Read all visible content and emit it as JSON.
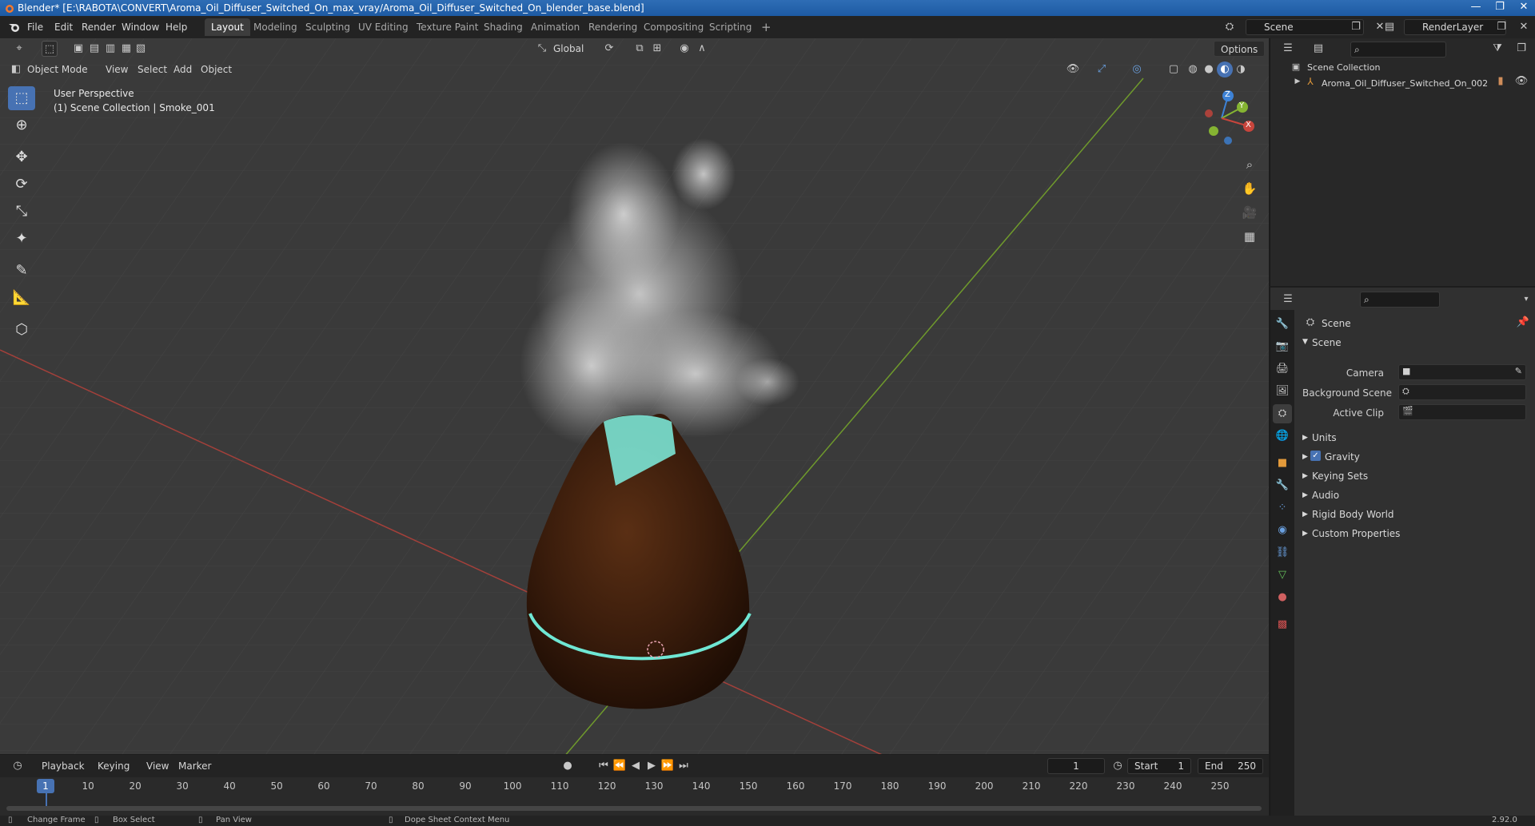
{
  "window": {
    "title": "Blender* [E:\\RABOTA\\CONVERT\\Aroma_Oil_Diffuser_Switched_On_max_vray/Aroma_Oil_Diffuser_Switched_On_blender_base.blend]",
    "minimize": "—",
    "maximize": "❐",
    "close": "✕"
  },
  "menu": [
    "File",
    "Edit",
    "Render",
    "Window",
    "Help"
  ],
  "workspaces": [
    "Layout",
    "Modeling",
    "Sculpting",
    "UV Editing",
    "Texture Paint",
    "Shading",
    "Animation",
    "Rendering",
    "Compositing",
    "Scripting"
  ],
  "active_workspace": "Layout",
  "add_workspace": "+",
  "scene_name": "Scene",
  "render_layer": "RenderLayer",
  "viewport": {
    "mode": "Object Mode",
    "menus": [
      "View",
      "Select",
      "Add",
      "Object"
    ],
    "transform_orientation": "Global",
    "options": "Options",
    "view_name": "User Perspective",
    "collection_info": "(1) Scene Collection | Smoke_001"
  },
  "gizmo": {
    "z": "Z",
    "y": "Y",
    "x": "X"
  },
  "outliner": {
    "root": "Scene Collection",
    "items": [
      "Aroma_Oil_Diffuser_Switched_On_002"
    ]
  },
  "properties": {
    "header": "Scene",
    "panel": "Scene",
    "camera_label": "Camera",
    "background_scene_label": "Background Scene",
    "active_clip_label": "Active Clip",
    "sections": [
      "Units",
      "Gravity",
      "Keying Sets",
      "Audio",
      "Rigid Body World",
      "Custom Properties"
    ],
    "gravity_enabled": true
  },
  "timeline": {
    "menus": [
      "Playback",
      "Keying",
      "View",
      "Marker"
    ],
    "current_frame": "1",
    "start_label": "Start",
    "start": "1",
    "end_label": "End",
    "end": "250",
    "ticks": [
      "1",
      "10",
      "20",
      "30",
      "40",
      "50",
      "60",
      "70",
      "80",
      "90",
      "100",
      "110",
      "120",
      "130",
      "140",
      "150",
      "160",
      "170",
      "180",
      "190",
      "200",
      "210",
      "220",
      "230",
      "240",
      "250"
    ]
  },
  "statusbar": {
    "items": [
      "Change Frame",
      "Box Select",
      "Pan View",
      "Dope Sheet Context Menu"
    ],
    "version": "2.92.0"
  },
  "colors": {
    "accent": "#4772b3",
    "x_axis": "#c8453c",
    "y_axis": "#85b432",
    "z_axis": "#3d82d6",
    "wood": "#3b1d0c",
    "glow": "#7ff0e0"
  }
}
